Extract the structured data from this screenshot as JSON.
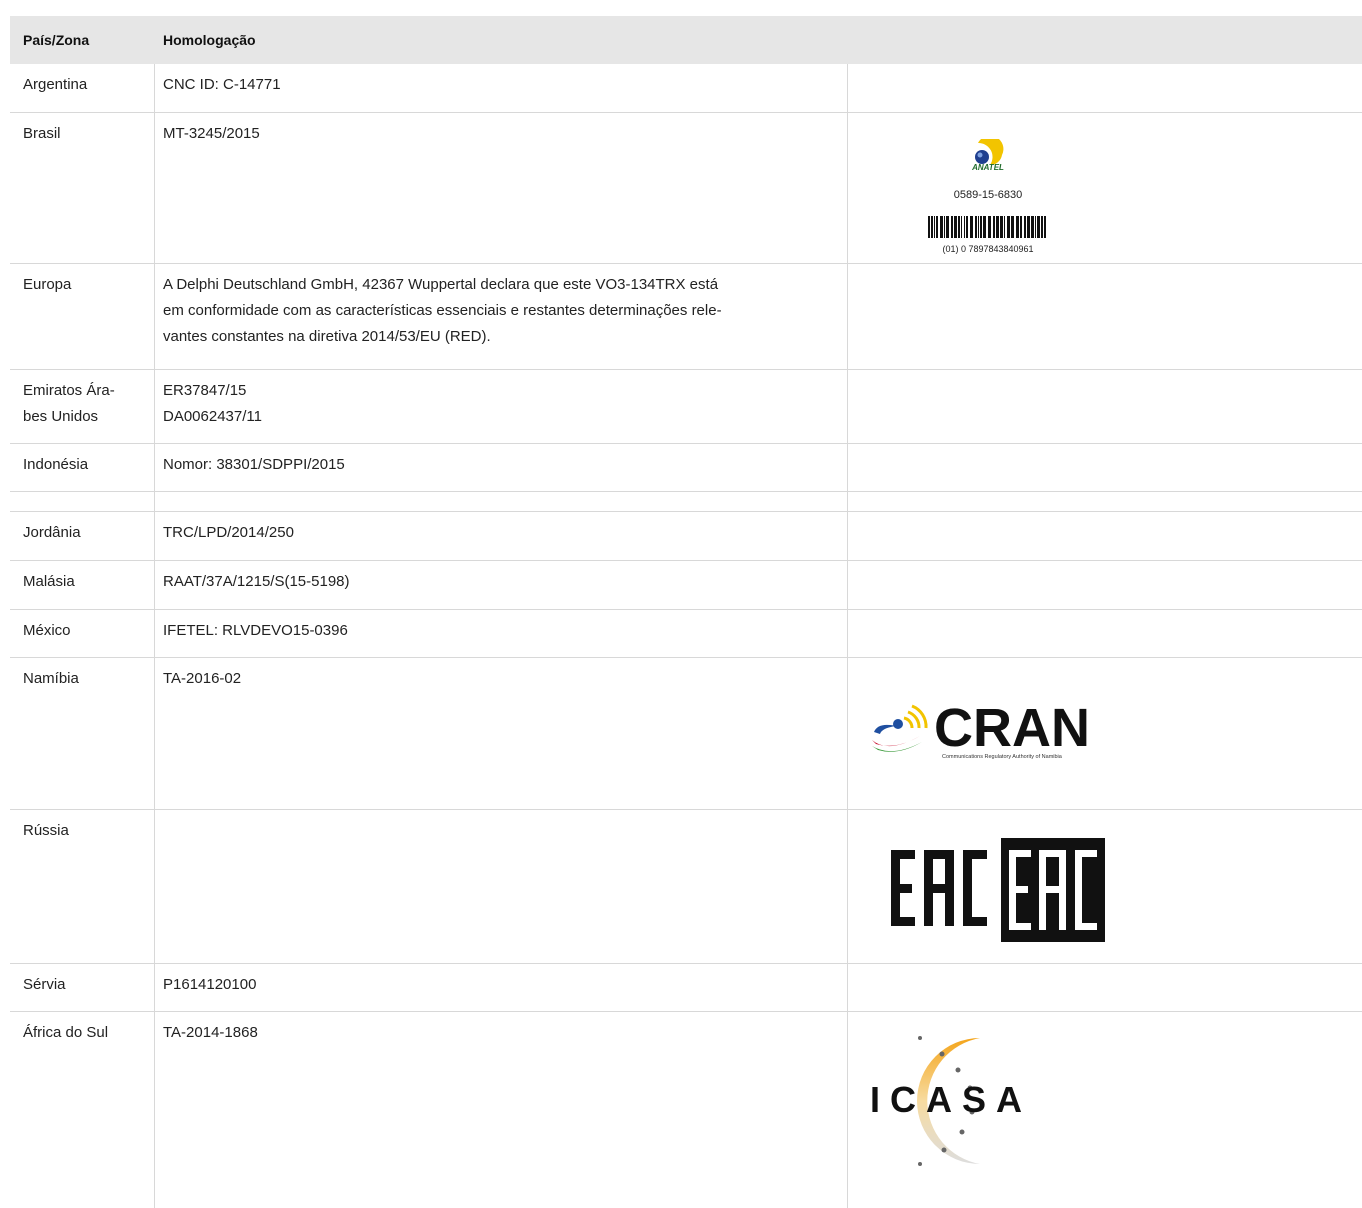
{
  "header": {
    "col1": "País/Zona",
    "col2": "Homologação"
  },
  "rows": [
    {
      "country": [
        "Argentina"
      ],
      "text": [
        "CNC ID: C-14771"
      ]
    },
    {
      "country": [
        "Brasil"
      ],
      "text": [
        "MT-3245/2015"
      ],
      "logo": {
        "name": "ANATEL",
        "number": "0589-15-6830",
        "barcode": "(01) 0 7897843840961"
      }
    },
    {
      "country": [
        "Europa"
      ],
      "text": [
        "A Delphi Deutschland GmbH, 42367 Wuppertal declara que este VO3-134TRX está",
        "em conformidade com as características essenciais e restantes determinações rele-",
        "vantes constantes na diretiva 2014/53/EU (RED)."
      ]
    },
    {
      "country": [
        "Emiratos Ára-",
        "bes Unidos"
      ],
      "text": [
        "ER37847/15",
        "DA0062437/11"
      ]
    },
    {
      "country": [
        "Indonésia"
      ],
      "text": [
        "Nomor: 38301/SDPPI/2015"
      ]
    },
    {
      "country": [
        ""
      ],
      "text": [
        ""
      ]
    },
    {
      "country": [
        "Jordânia"
      ],
      "text": [
        "TRC/LPD/2014/250"
      ]
    },
    {
      "country": [
        "Malásia"
      ],
      "text": [
        "RAAT/37A/1215/S(15-5198)"
      ]
    },
    {
      "country": [
        "México"
      ],
      "text": [
        "IFETEL: RLVDEVO15-0396"
      ]
    },
    {
      "country": [
        "Namíbia"
      ],
      "text": [
        "TA-2016-02"
      ],
      "logo": {
        "name": "CRAN",
        "subtitle": "Communications Regulatory Authority of Namibia"
      }
    },
    {
      "country": [
        "Rússia"
      ],
      "text": [
        ""
      ],
      "logo": {
        "name": "EAC"
      }
    },
    {
      "country": [
        "Sérvia"
      ],
      "text": [
        "P1614120100"
      ]
    },
    {
      "country": [
        "África do Sul"
      ],
      "text": [
        "TA-2014-1868"
      ],
      "logo": {
        "name": "ICASA"
      }
    }
  ]
}
